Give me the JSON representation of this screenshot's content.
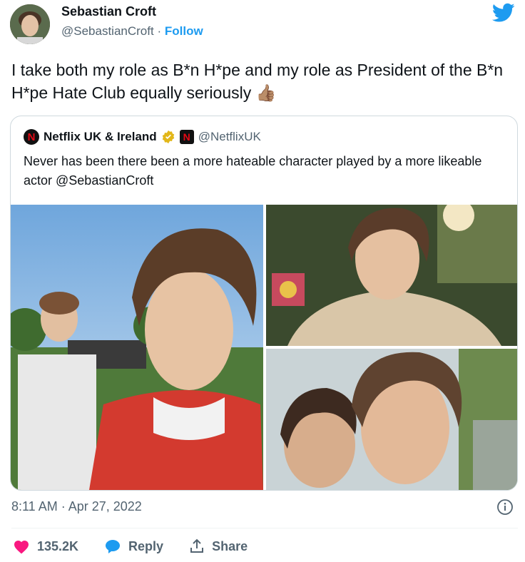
{
  "author": {
    "name": "Sebastian Croft",
    "handle": "@SebastianCroft",
    "separator": "·",
    "follow_label": "Follow"
  },
  "tweet": {
    "text": "I take both my role as B*n H*pe and my role as President of the B*n H*pe Hate Club equally seriously 👍🏽"
  },
  "quote": {
    "name": "Netflix UK & Ireland",
    "handle": "@NetflixUK",
    "logo_letter": "N",
    "text": "Never has been there been a more hateable character played by a more likeable actor @SebastianCroft"
  },
  "meta": {
    "time": "8:11 AM · Apr 27, 2022"
  },
  "actions": {
    "like_count": "135.2K",
    "reply_label": "Reply",
    "share_label": "Share"
  },
  "colors": {
    "accent": "#1d9bf0",
    "like": "#f91880",
    "muted": "#536471"
  }
}
